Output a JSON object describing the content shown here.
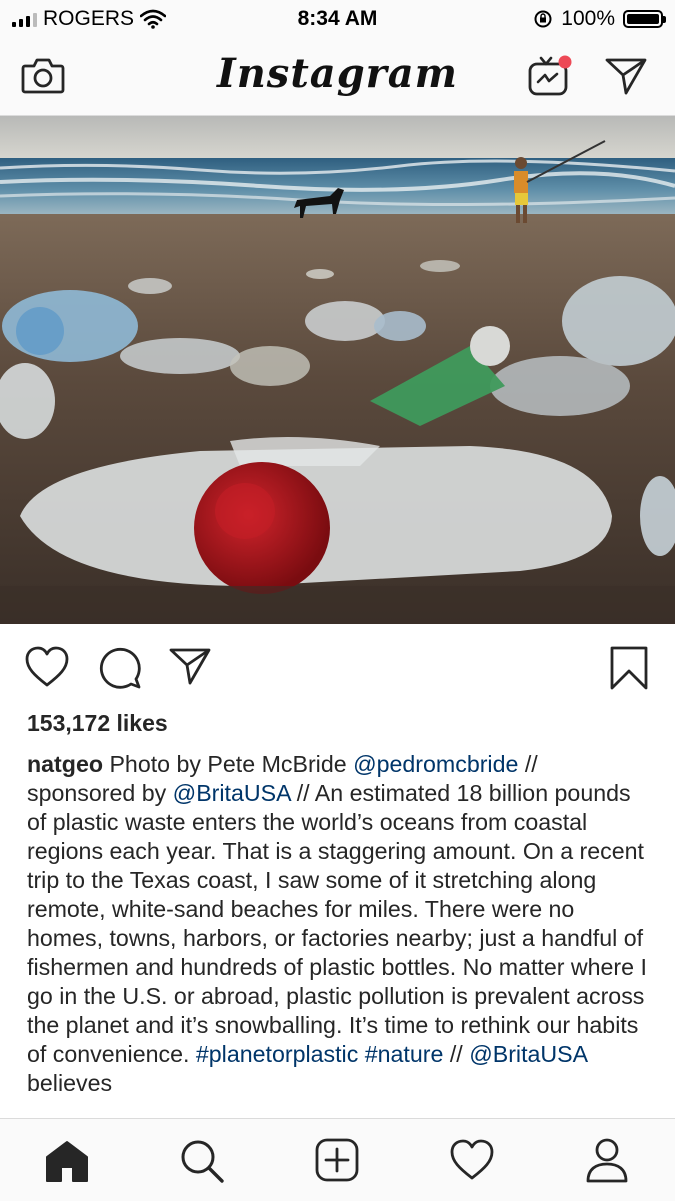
{
  "status_bar": {
    "carrier": "ROGERS",
    "time": "8:34 AM",
    "battery": "100%"
  },
  "header": {
    "logo_text": "Instagram",
    "notification_dot_color": "#ed4956"
  },
  "post": {
    "likes": "153,172 likes",
    "username": "natgeo",
    "caption": [
      {
        "text": " Photo by Pete McBride "
      },
      {
        "text": "@pedromcbride",
        "link": true
      },
      {
        "text": " // sponsored by "
      },
      {
        "text": "@BritaUSA",
        "link": true
      },
      {
        "text": " // An estimated 18 billion pounds of plastic waste enters the world’s oceans from coastal regions each year. That is a staggering amount. On a recent trip to the Texas coast, I saw some of it stretching along remote, white-sand beaches for miles. There were no homes, towns, harbors, or factories nearby; just a handful of fishermen and hundreds of plastic bottles. No matter where I go in the U.S. or abroad, plastic pollution is prevalent across the planet and it’s snowballing. It’s time to rethink our habits of convenience. "
      },
      {
        "text": "#planetorplastic",
        "link": true
      },
      {
        "text": " "
      },
      {
        "text": "#nature",
        "link": true
      },
      {
        "text": " // "
      },
      {
        "text": "@BritaUSA",
        "link": true
      },
      {
        "text": " believes"
      }
    ]
  },
  "icons": {
    "camera": "camera-icon",
    "igtv": "igtv-icon",
    "direct": "direct-message-icon",
    "like": "heart-icon",
    "comment": "comment-icon",
    "share": "share-icon",
    "save": "bookmark-icon",
    "home": "home-icon",
    "search": "search-icon",
    "add": "add-post-icon",
    "activity": "activity-heart-icon",
    "profile": "profile-icon"
  },
  "colors": {
    "link": "#003569",
    "text": "#262626",
    "bar_bg": "#fafafa"
  }
}
